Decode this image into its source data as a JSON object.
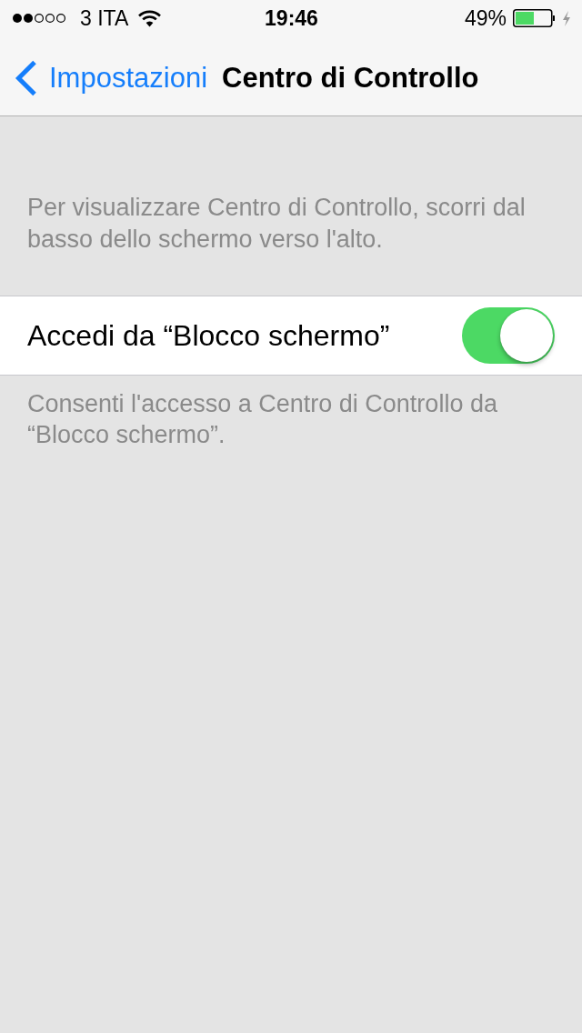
{
  "status_bar": {
    "carrier": "3 ITA",
    "time": "19:46",
    "battery": "49%"
  },
  "nav_bar": {
    "back": "Impostazioni",
    "title": "Centro di Controllo"
  },
  "sections": [
    {
      "header": "Per visualizzare Centro di Controllo, scorri dal basso dello schermo verso l'alto.",
      "rows": [
        {
          "label": "Accedi da “Blocco schermo”",
          "on": true
        }
      ],
      "footer": "Consenti l'accesso a Centro di Controllo da “Blocco schermo”."
    }
  ]
}
